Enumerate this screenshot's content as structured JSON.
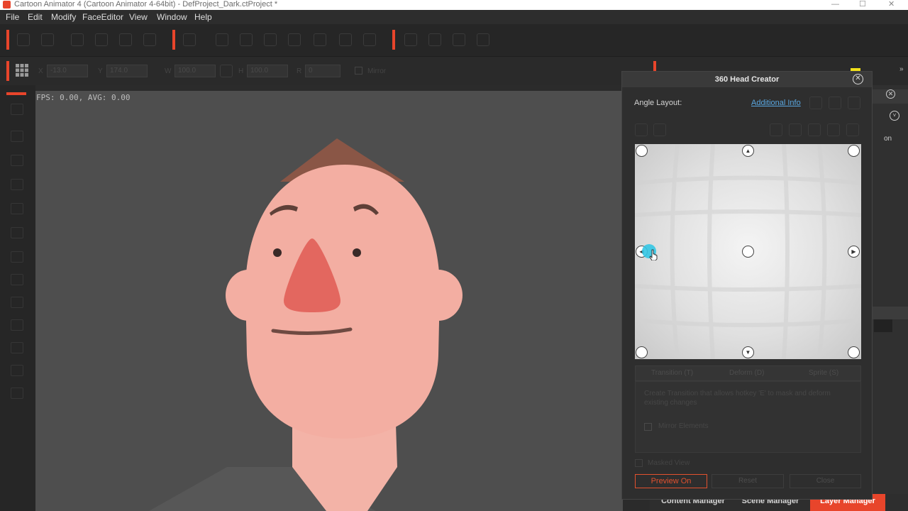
{
  "app": {
    "window_title": "Cartoon Animator 4  (Cartoon Animator 4-64bit) - DefProject_Dark.ctProject *",
    "window_controls": [
      "—",
      "☐",
      "✕"
    ]
  },
  "menu": [
    "File",
    "Edit",
    "Modify",
    "FaceEditor",
    "View",
    "Window",
    "Help"
  ],
  "transform_bar": {
    "x": "-13.0",
    "y": "174.0",
    "w": "100.0",
    "h": "100.0",
    "r": "0",
    "x_label": "X",
    "y_label": "Y",
    "w_label": "W",
    "h_label": "H",
    "r_label": "R",
    "mirror_label": "Mirror"
  },
  "stage": {
    "fps_text": "FPS: 0.00, AVG: 0.00"
  },
  "dialog": {
    "title": "360 Head Creator",
    "angle_layout_label": "Angle Layout:",
    "additional_info_link": "Additional Info",
    "tabs": [
      "Transition (T)",
      "Deform (D)",
      "Sprite (S)"
    ],
    "hint_text": "Create Transition that allows hotkey 'E' to mask and deform existing changes",
    "mirror_elements_label": "Mirror Elements",
    "masked_view_label": "Masked View",
    "preview_button": "Preview On",
    "reset_button": "Reset",
    "close_button": "Close"
  },
  "bottom_tabs": [
    "Content Manager",
    "Scene Manager",
    "Layer Manager"
  ],
  "right_panel": {
    "partial_label": "on"
  },
  "colors": {
    "accent": "#e8452b",
    "link": "#5aa7e0",
    "cursor_highlight": "#34c6e4",
    "skin": "#f3aea2",
    "nose": "#e3675f",
    "hair": "#8a5646",
    "stage_bg": "#4e4e4e"
  }
}
